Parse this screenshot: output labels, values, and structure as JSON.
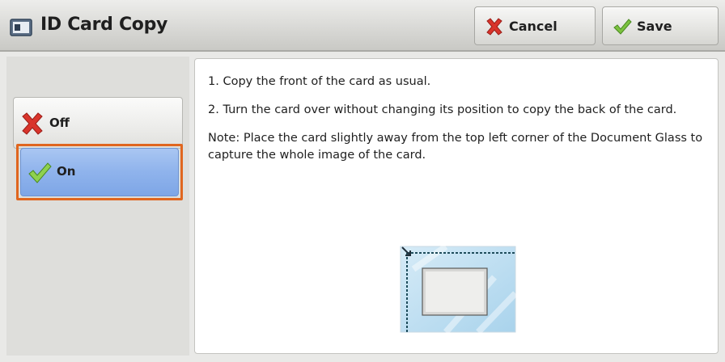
{
  "header": {
    "title": "ID Card Copy",
    "title_icon": "id-card-copy-icon",
    "cancel_label": "Cancel",
    "cancel_icon": "red-x-icon",
    "save_label": "Save",
    "save_icon": "green-check-icon"
  },
  "options": {
    "off_label": "Off",
    "off_icon": "red-x-icon",
    "on_label": "On",
    "on_icon": "green-check-icon",
    "selected": "On"
  },
  "info": {
    "step1": "1. Copy the front of the card as usual.",
    "step2": "2. Turn the card over without changing its position to copy the back of the card.",
    "note": "Note: Place the card slightly away from the top left corner of the Document Glass to capture the whole image of the card.",
    "illustration_icon": "card-on-document-glass-icon"
  },
  "colors": {
    "selected_highlight": "#e0661f",
    "selected_fill": "#8fb3ec",
    "cancel_red": "#d9342b",
    "save_green": "#7cc23f"
  }
}
